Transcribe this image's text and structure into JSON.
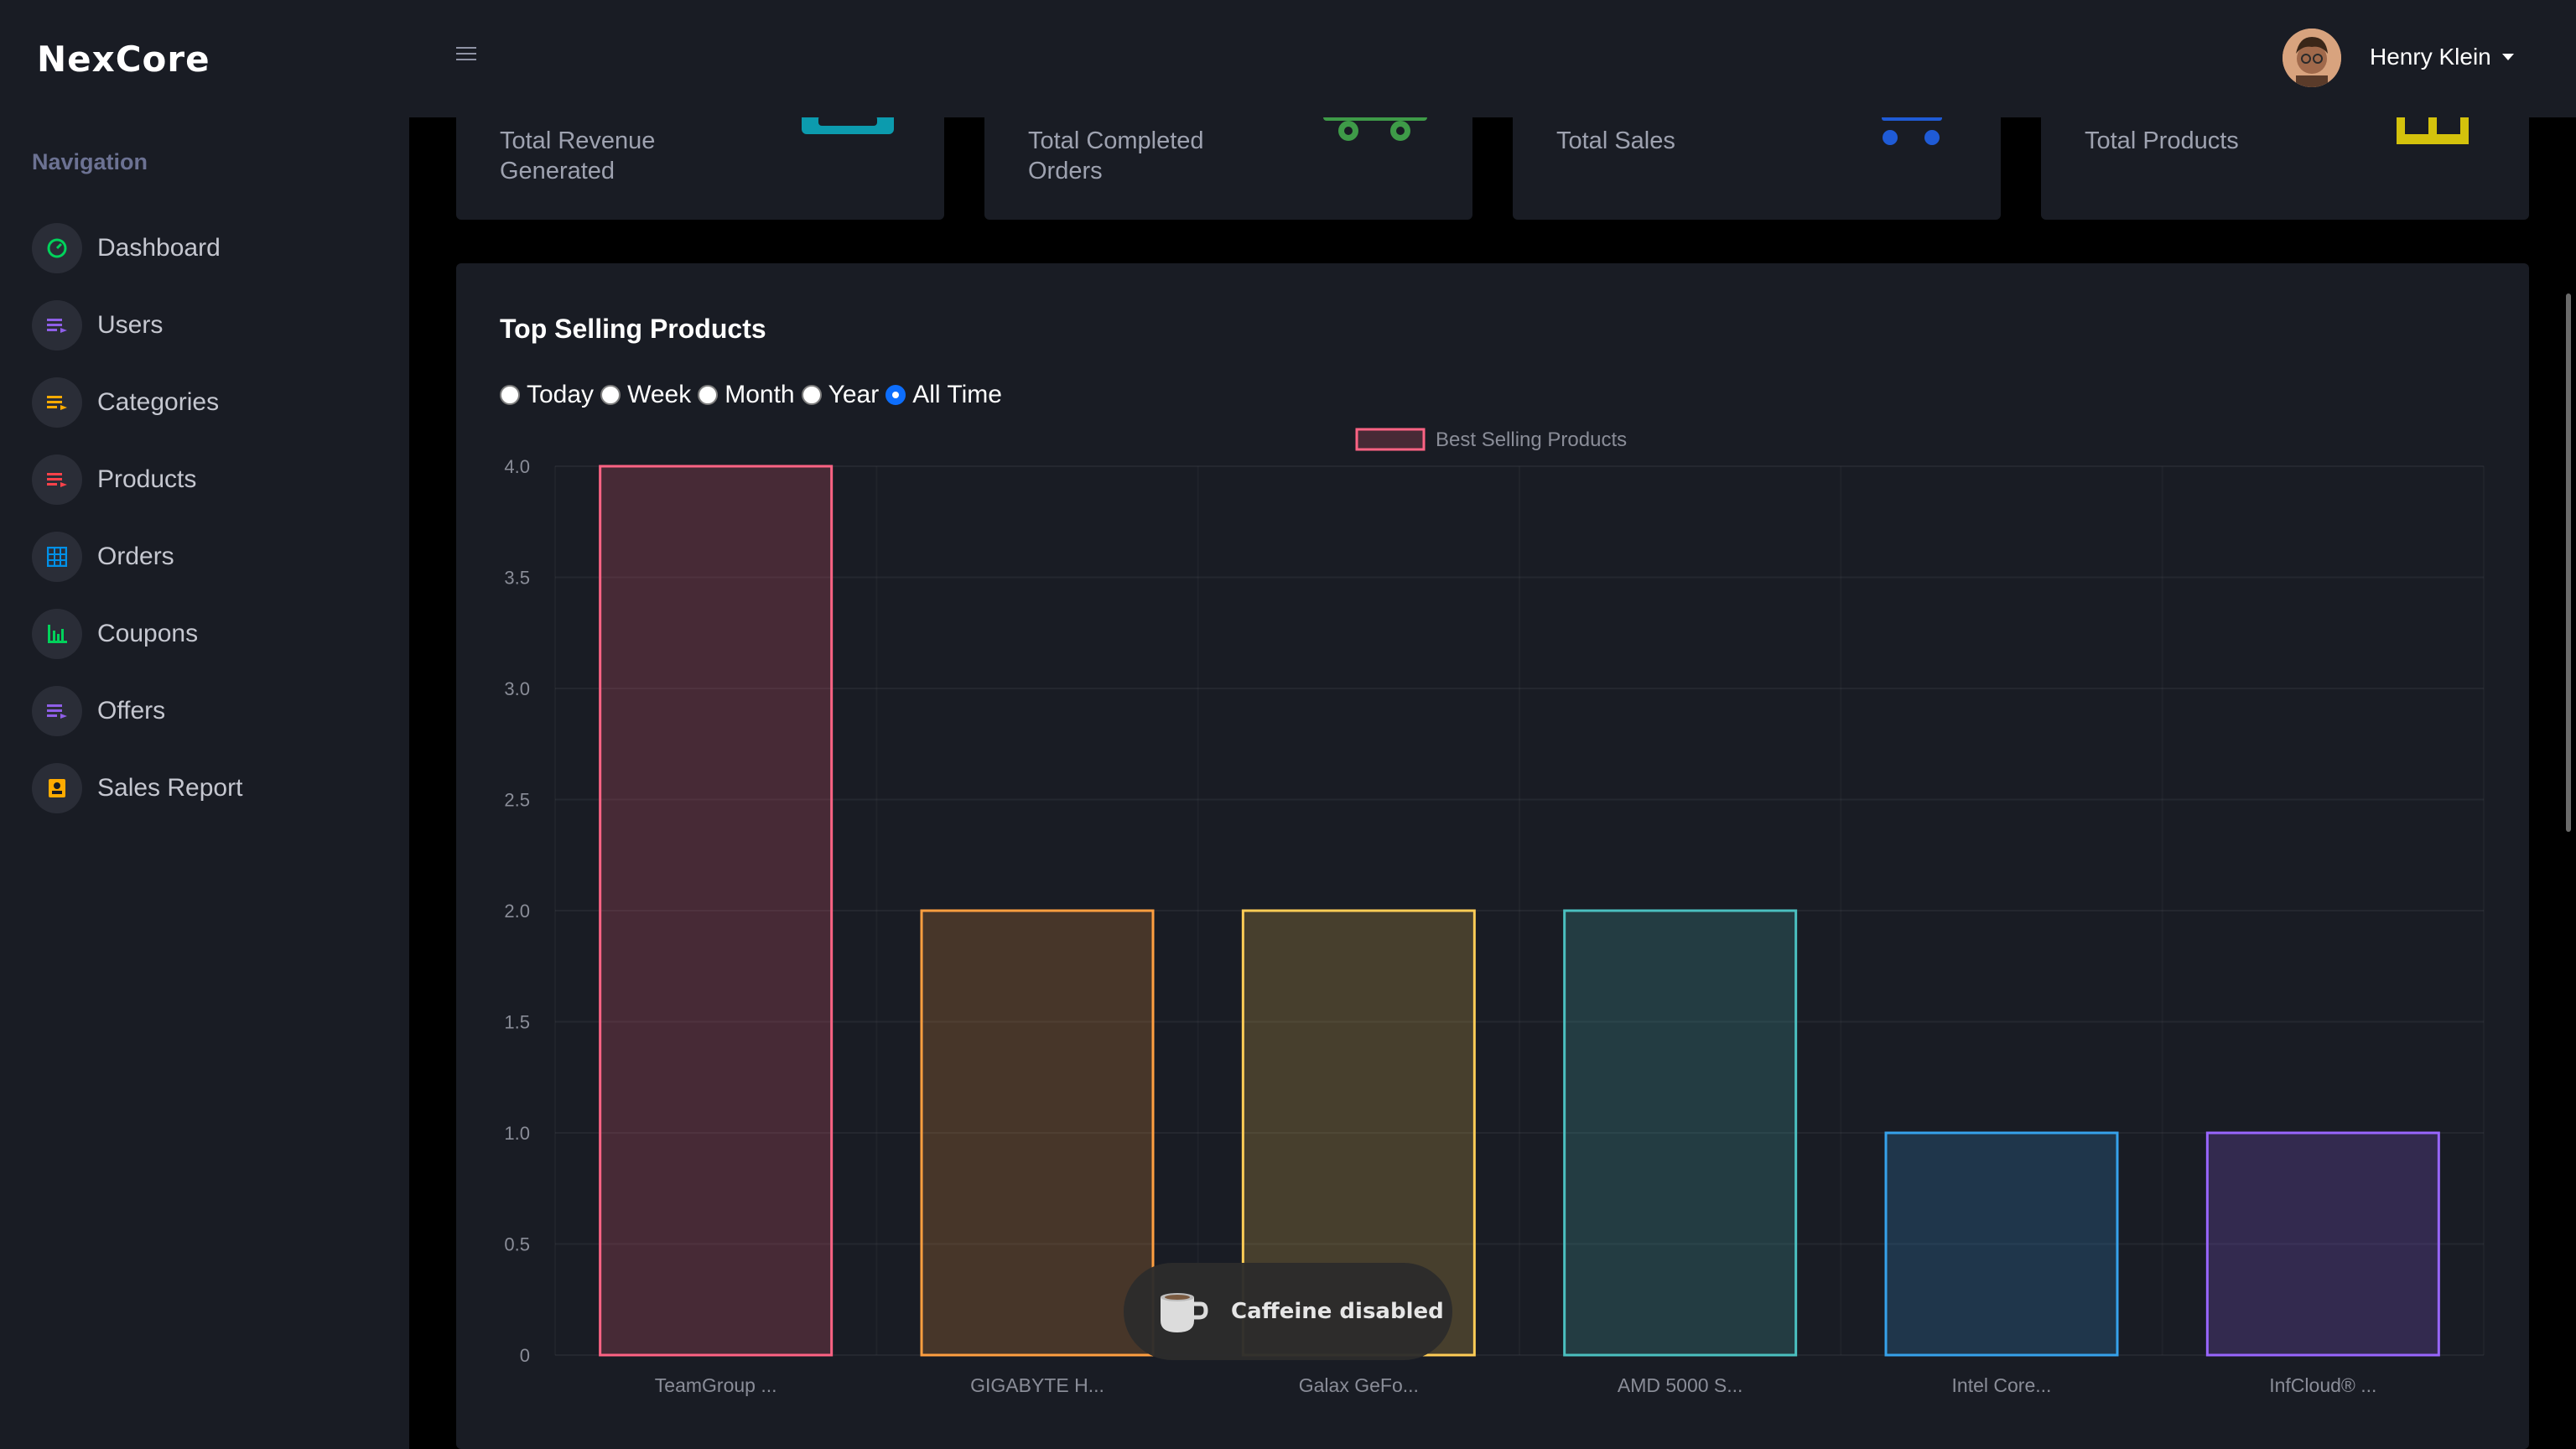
{
  "app": {
    "logo": "NexCore"
  },
  "sidebar": {
    "heading": "Navigation",
    "items": [
      {
        "label": "Dashboard",
        "icon": "speedometer-icon",
        "color": "#00d25b"
      },
      {
        "label": "Users",
        "icon": "list-icon",
        "color": "#8f5fe8"
      },
      {
        "label": "Categories",
        "icon": "list-icon",
        "color": "#ffab00"
      },
      {
        "label": "Products",
        "icon": "list-icon",
        "color": "#fc424a"
      },
      {
        "label": "Orders",
        "icon": "table-icon",
        "color": "#0090e7"
      },
      {
        "label": "Coupons",
        "icon": "chart-bar-icon",
        "color": "#00d25b"
      },
      {
        "label": "Offers",
        "icon": "list-icon",
        "color": "#8f5fe8"
      },
      {
        "label": "Sales Report",
        "icon": "contacts-icon",
        "color": "#ffab00"
      }
    ]
  },
  "header": {
    "user_name": "Henry Klein"
  },
  "stats": [
    {
      "label": "Total Revenue Generated",
      "icon": "cash-icon",
      "color": "#0c9bae"
    },
    {
      "label": "Total Completed Orders",
      "icon": "truck-icon",
      "color": "#3e9b48"
    },
    {
      "label": "Total Sales",
      "icon": "cart-icon",
      "color": "#1f5bd6"
    },
    {
      "label": "Total Products",
      "icon": "box-icon",
      "color": "#d4c20c"
    }
  ],
  "chart_card": {
    "title": "Top Selling Products",
    "filters": [
      {
        "label": "Today",
        "checked": false
      },
      {
        "label": "Week",
        "checked": false
      },
      {
        "label": "Month",
        "checked": false
      },
      {
        "label": "Year",
        "checked": false
      },
      {
        "label": "All Time",
        "checked": true
      }
    ]
  },
  "chart_data": {
    "type": "bar",
    "categories": [
      "TeamGroup ...",
      "GIGABYTE H...",
      "Galax GeFo...",
      "AMD 5000 S...",
      "Intel Core...",
      "InfCloud® ..."
    ],
    "series": [
      {
        "name": "Best Selling Products",
        "values": [
          4,
          2,
          2,
          2,
          1,
          1
        ]
      }
    ],
    "bar_colors": [
      "#ff6384",
      "#ff9f40",
      "#ffcd56",
      "#4bc0c0",
      "#36a2eb",
      "#9966ff"
    ],
    "ylim": [
      0,
      4
    ],
    "yticks": [
      "0",
      "0.5",
      "1.0",
      "1.5",
      "2.0",
      "2.5",
      "3.0",
      "3.5",
      "4.0"
    ],
    "legend_position": "top",
    "grid": true
  },
  "toast": {
    "text": "Caffeine disabled"
  }
}
